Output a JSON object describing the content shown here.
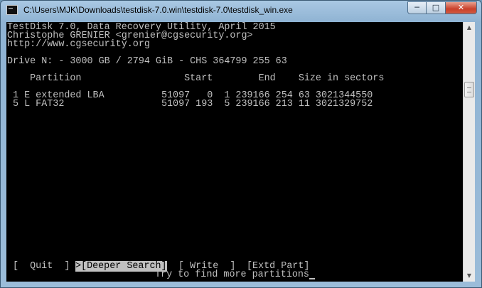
{
  "window": {
    "title": "C:\\Users\\MJK\\Downloads\\testdisk-7.0.win\\testdisk-7.0\\testdisk_win.exe",
    "minimize_icon": "─",
    "maximize_icon": "□",
    "close_icon": "✕"
  },
  "console": {
    "header_line1": "TestDisk 7.0, Data Recovery Utility, April 2015",
    "header_line2": "Christophe GRENIER <grenier@cgsecurity.org>",
    "header_line3": "http://www.cgsecurity.org",
    "drive_line": "Drive N: - 3000 GB / 2794 GiB - CHS 364799 255 63",
    "column_header": "    Partition                  Start        End    Size in sectors",
    "partitions": [
      " 1 E extended LBA          51097   0  1 239166 254 63 3021344550",
      " 5 L FAT32                 51097 193  5 239166 213 11 3021329752"
    ],
    "menu": {
      "quit": "[  Quit  ]",
      "deeper_search": ">[Deeper Search]",
      "write": "[ Write  ]",
      "extd_part": "[Extd Part]"
    },
    "hint": "Try to find more partitions"
  },
  "scrollbar": {
    "up_icon": "▲",
    "down_icon": "▼"
  }
}
